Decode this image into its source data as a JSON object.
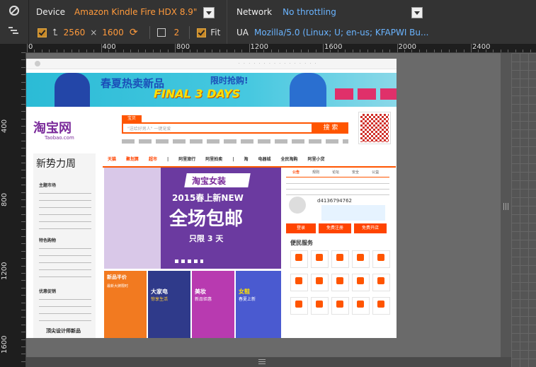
{
  "toolbar": {
    "device_label": "Device",
    "device_value": "Amazon Kindle Fire HDX 8.9\"",
    "network_label": "Network",
    "network_value": "No throttling",
    "width": "2560",
    "times": "×",
    "height": "1600",
    "ratio": "2",
    "fit_label": "Fit",
    "ua_label": "UA",
    "ua_value": "Mozilla/5.0 (Linux; U; en-us; KFAPWI Bu..."
  },
  "ruler": {
    "h": [
      "0",
      "400",
      "800",
      "1200",
      "1600",
      "2000",
      "2400"
    ],
    "v": [
      "400",
      "800",
      "1200",
      "1600"
    ]
  },
  "page": {
    "banner_text": "春夏热卖新品",
    "banner_big": "FINAL 3 DAYS",
    "banner_sub": "限时抢购!",
    "logo": "淘宝网",
    "logo_sub": "Taobao.com",
    "search_tab": "宝贝",
    "search_btn": "搜 索",
    "search_placeholder": "\"送给好男人\" 一键宠爱",
    "nav": [
      "天猫",
      "聚划算",
      "超市",
      "|",
      "阿里旅行",
      "阿里拍卖",
      "|",
      "淘",
      "电器城",
      "全民淘购",
      "阿里小贷"
    ],
    "side_title": "新势力周",
    "side_sections": [
      "主题市场",
      "特色购物",
      "优惠促销"
    ],
    "side_bottom": "顶尖设计师新品",
    "ban_title": "淘宝女装",
    "ban_year": "2015春上新NEW",
    "ban_main": "全场包邮",
    "ban_limit": "只限 3 天",
    "tiles": [
      "新品半价",
      "大家电",
      "美妆",
      "女鞋"
    ],
    "tiles_sub": [
      "最新大牌限时",
      "惊享生活",
      "新品钜惠",
      "春夏上新"
    ],
    "right_tabs": [
      "公告",
      "规则",
      "论坛",
      "安全",
      "公益"
    ],
    "user_id": "d4136794762",
    "services_title": "便民服务",
    "service_btns": [
      "登录",
      "免费注册",
      "免费开店"
    ]
  }
}
